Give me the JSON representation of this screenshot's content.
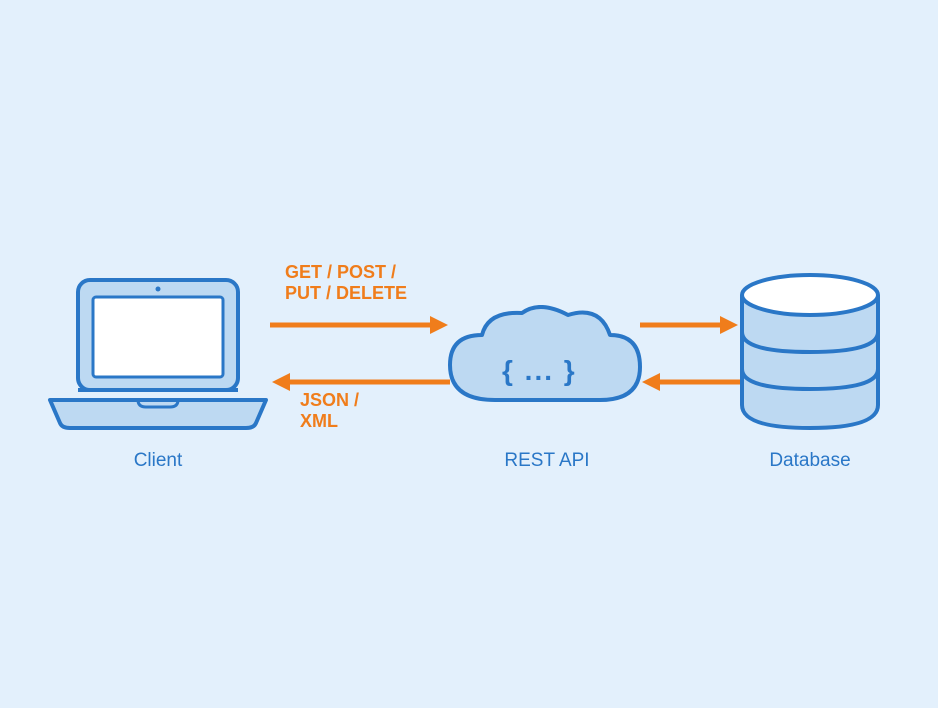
{
  "nodes": {
    "client": {
      "label": "Client"
    },
    "api": {
      "label": "REST API",
      "braces": "{ ... }"
    },
    "database": {
      "label": "Database"
    }
  },
  "arrows": {
    "request": {
      "label": "GET / POST /\nPUT / DELETE"
    },
    "response": {
      "label": "JSON /\nXML"
    }
  },
  "colors": {
    "bg": "#e3f0fc",
    "stroke": "#2a77c7",
    "lightfill": "#bdd9f2",
    "white": "#ffffff",
    "arrow": "#f07d1b"
  }
}
